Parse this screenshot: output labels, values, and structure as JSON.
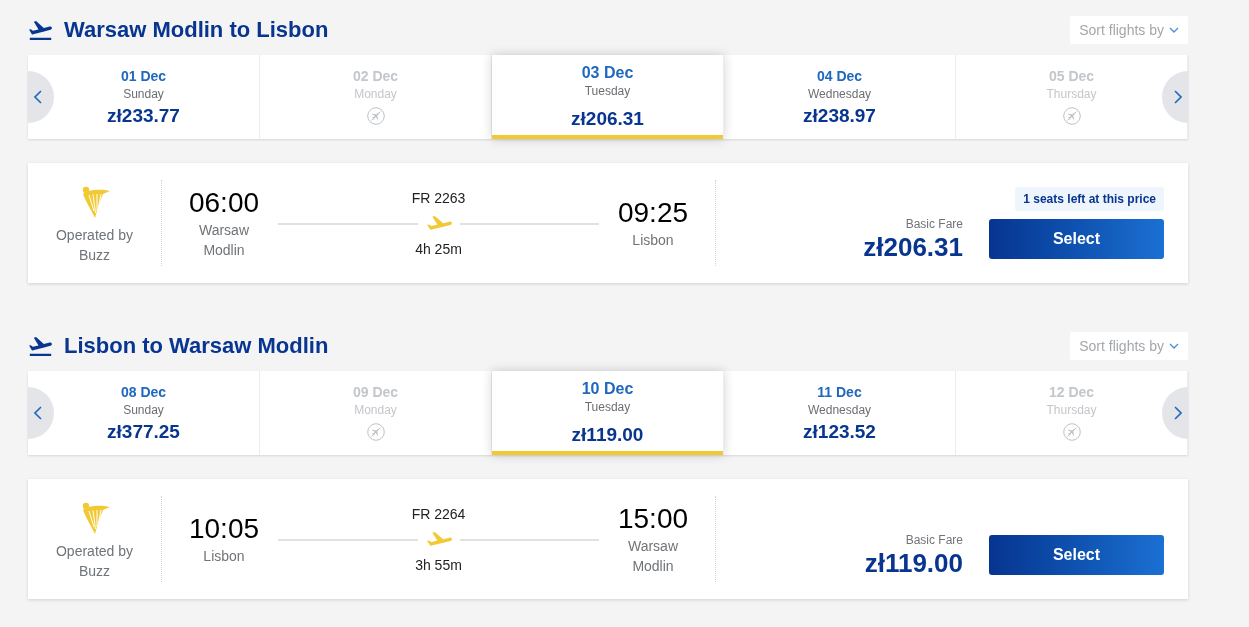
{
  "sections": [
    {
      "title": "Warsaw Modlin to Lisbon",
      "sort_button": "Sort flights by",
      "dates": [
        {
          "date": "01 Dec",
          "day": "Sunday",
          "price": "zł233.77",
          "available": true,
          "selected": false
        },
        {
          "date": "02 Dec",
          "day": "Monday",
          "available": false,
          "selected": false
        },
        {
          "date": "03 Dec",
          "day": "Tuesday",
          "price": "zł206.31",
          "available": true,
          "selected": true
        },
        {
          "date": "04 Dec",
          "day": "Wednesday",
          "price": "zł238.97",
          "available": true,
          "selected": false
        },
        {
          "date": "05 Dec",
          "day": "Thursday",
          "available": false,
          "selected": false
        }
      ],
      "flight": {
        "operator": "Operated by Buzz",
        "departure_time": "06:00",
        "departure_city": "Warsaw Modlin",
        "flight_number": "FR 2263",
        "duration": "4h 25m",
        "arrival_time": "09:25",
        "arrival_city": "Lisbon",
        "seats_badge": "1 seats left at this price",
        "fare_label": "Basic Fare",
        "price": "zł206.31",
        "select_button": "Select"
      }
    },
    {
      "title": "Lisbon to Warsaw Modlin",
      "sort_button": "Sort flights by",
      "dates": [
        {
          "date": "08 Dec",
          "day": "Sunday",
          "price": "zł377.25",
          "available": true,
          "selected": false
        },
        {
          "date": "09 Dec",
          "day": "Monday",
          "available": false,
          "selected": false
        },
        {
          "date": "10 Dec",
          "day": "Tuesday",
          "price": "zł119.00",
          "available": true,
          "selected": true
        },
        {
          "date": "11 Dec",
          "day": "Wednesday",
          "price": "zł123.52",
          "available": true,
          "selected": false
        },
        {
          "date": "12 Dec",
          "day": "Thursday",
          "available": false,
          "selected": false
        }
      ],
      "flight": {
        "operator": "Operated by Buzz",
        "departure_time": "10:05",
        "departure_city": "Lisbon",
        "flight_number": "FR 2264",
        "duration": "3h 55m",
        "arrival_time": "15:00",
        "arrival_city": "Warsaw Modlin",
        "fare_label": "Basic Fare",
        "price": "zł119.00",
        "select_button": "Select"
      }
    }
  ]
}
